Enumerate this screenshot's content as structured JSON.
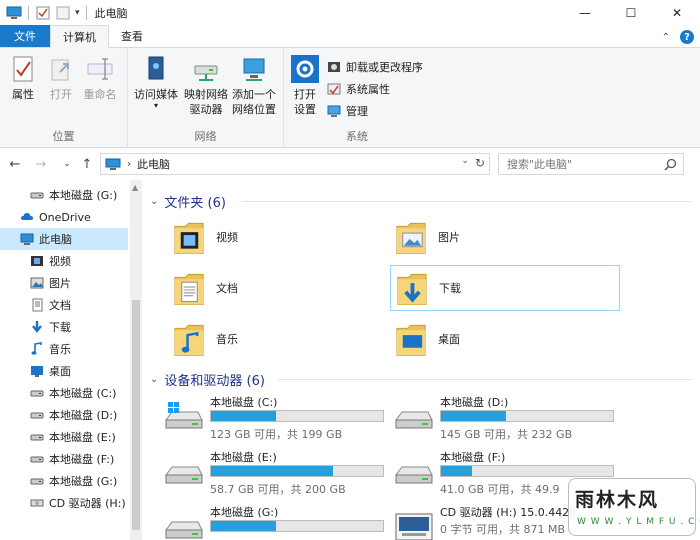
{
  "window": {
    "title": "此电脑",
    "controls": [
      "minimize-icon",
      "maximize-icon",
      "close-icon"
    ]
  },
  "ribbon": {
    "tabs": [
      {
        "label": "文件"
      },
      {
        "label": "计算机"
      },
      {
        "label": "查看"
      }
    ],
    "groups": {
      "location": {
        "label": "位置",
        "buttons": [
          {
            "label": "属性",
            "icon": "properties-icon",
            "enabled": true
          },
          {
            "label": "打开",
            "icon": "open-icon",
            "enabled": false
          },
          {
            "label": "重命名",
            "icon": "rename-icon",
            "enabled": false
          }
        ]
      },
      "network": {
        "label": "网络",
        "buttons": [
          {
            "label": "访问媒体",
            "icon": "media-icon"
          },
          {
            "label": "映射网络\n驱动器",
            "icon": "map-drive-icon"
          },
          {
            "label": "添加一个\n网络位置",
            "icon": "network-location-icon"
          }
        ]
      },
      "system": {
        "label": "系统",
        "open_settings": "打开\n设置",
        "small_buttons": [
          {
            "label": "卸载或更改程序",
            "icon": "uninstall-icon"
          },
          {
            "label": "系统属性",
            "icon": "system-properties-icon"
          },
          {
            "label": "管理",
            "icon": "manage-icon"
          }
        ]
      }
    }
  },
  "addressbar": {
    "path": "此电脑",
    "search_placeholder": "搜索\"此电脑\""
  },
  "navpane": {
    "items": [
      {
        "label": "本地磁盘 (G:)",
        "icon": "drive-icon",
        "indent": 1
      },
      {
        "label": "OneDrive",
        "icon": "onedrive-icon",
        "indent": 0
      },
      {
        "label": "此电脑",
        "icon": "computer-icon",
        "indent": 0,
        "selected": true
      },
      {
        "label": "视频",
        "icon": "videos-icon",
        "indent": 1
      },
      {
        "label": "图片",
        "icon": "pictures-icon",
        "indent": 1
      },
      {
        "label": "文档",
        "icon": "documents-icon",
        "indent": 1
      },
      {
        "label": "下载",
        "icon": "downloads-icon",
        "indent": 1
      },
      {
        "label": "音乐",
        "icon": "music-icon",
        "indent": 1
      },
      {
        "label": "桌面",
        "icon": "desktop-icon",
        "indent": 1
      },
      {
        "label": "本地磁盘 (C:)",
        "icon": "drive-icon",
        "indent": 1
      },
      {
        "label": "本地磁盘 (D:)",
        "icon": "drive-icon",
        "indent": 1
      },
      {
        "label": "本地磁盘 (E:)",
        "icon": "drive-icon",
        "indent": 1
      },
      {
        "label": "本地磁盘 (F:)",
        "icon": "drive-icon",
        "indent": 1
      },
      {
        "label": "本地磁盘 (G:)",
        "icon": "drive-icon",
        "indent": 1
      },
      {
        "label": "CD 驱动器 (H:)",
        "icon": "cd-drive-icon",
        "indent": 1
      }
    ]
  },
  "content": {
    "folders_header": "文件夹 (6)",
    "folders": [
      {
        "label": "视频",
        "icon": "videos-folder-icon"
      },
      {
        "label": "图片",
        "icon": "pictures-folder-icon"
      },
      {
        "label": "文档",
        "icon": "documents-folder-icon"
      },
      {
        "label": "下载",
        "icon": "downloads-folder-icon"
      },
      {
        "label": "音乐",
        "icon": "music-folder-icon"
      },
      {
        "label": "桌面",
        "icon": "desktop-folder-icon"
      }
    ],
    "drives_header": "设备和驱动器 (6)",
    "drives": [
      {
        "name": "本地磁盘 (C:)",
        "info": "123 GB 可用，共 199 GB",
        "used_fraction": 0.38,
        "icon": "windows-drive-icon"
      },
      {
        "name": "本地磁盘 (D:)",
        "info": "145 GB 可用，共 232 GB",
        "used_fraction": 0.38,
        "icon": "drive-icon"
      },
      {
        "name": "本地磁盘 (E:)",
        "info": "58.7 GB 可用，共 200 GB",
        "used_fraction": 0.71,
        "icon": "drive-icon"
      },
      {
        "name": "本地磁盘 (F:)",
        "info": "41.0 GB 可用，共 49.9",
        "used_fraction": 0.18,
        "icon": "drive-icon"
      },
      {
        "name": "本地磁盘 (G:)",
        "info": "",
        "used_fraction": 0.38,
        "icon": "drive-icon"
      },
      {
        "name": "CD 驱动器 (H:) 15.0.4420",
        "info": "0 字节 可用，共 871 MB",
        "used_fraction": null,
        "icon": "cd-drive-icon"
      }
    ]
  },
  "watermark": {
    "brand": "雨林木风",
    "url": "W W W . Y L M F U . C O M"
  },
  "colors": {
    "accent": "#1979ca",
    "drive_bar": "#26a0da",
    "section_header": "#1e3287",
    "selection": "#cce8ff"
  }
}
